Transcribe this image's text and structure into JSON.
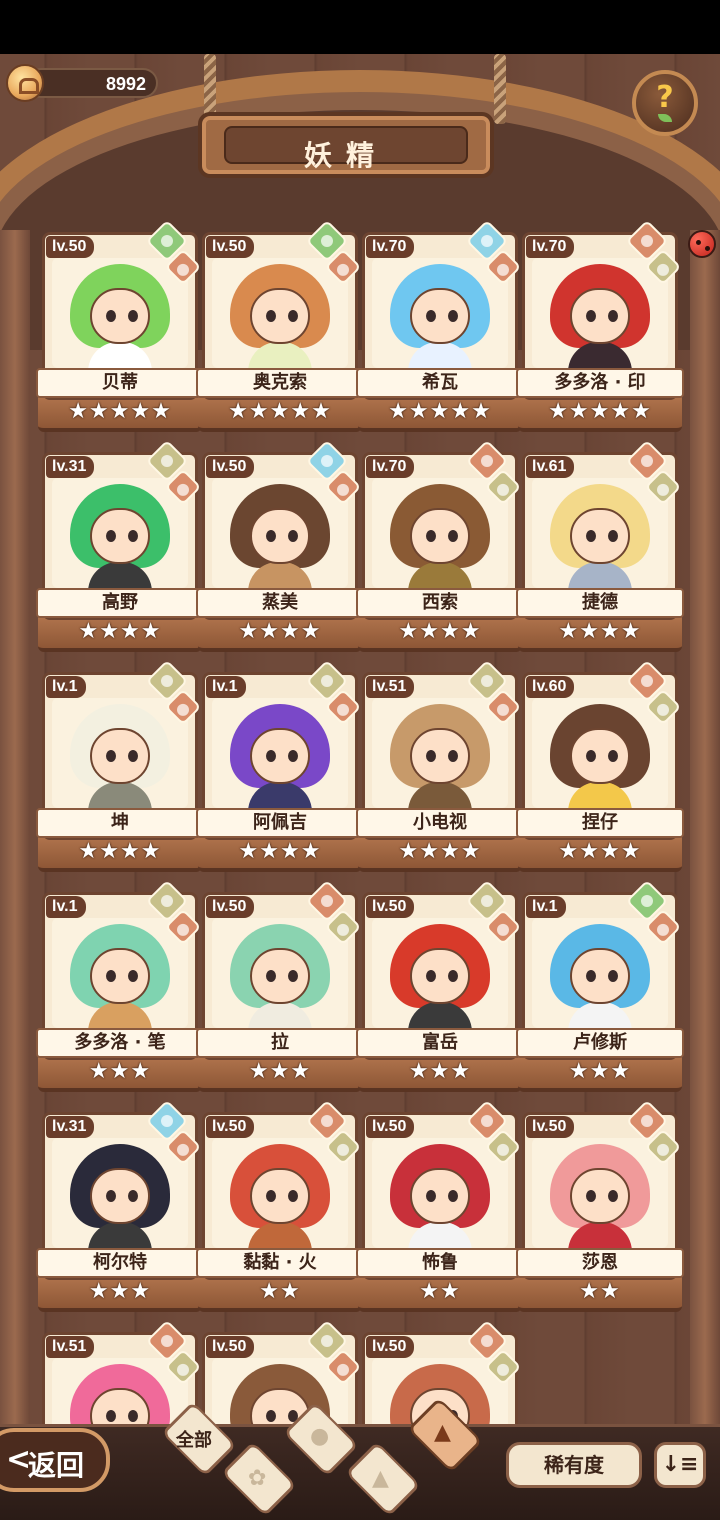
{
  "header": {
    "coins": "8992",
    "title": "妖精",
    "help_glyph": "?"
  },
  "colors": {
    "grass": "#8fc97a",
    "water": "#8fd3e6",
    "fire": "#d98c6a",
    "earth": "#c7c08a"
  },
  "fairies": [
    {
      "level": "lv.50",
      "name": "贝蒂",
      "stars": "★★★★★",
      "element": "grass-icon",
      "hair": "#7fd35c",
      "body": "#ffffff"
    },
    {
      "level": "lv.50",
      "name": "奥克索",
      "stars": "★★★★★",
      "element": "grass-icon",
      "hair": "#d98a4e",
      "body": "#e9f0c0"
    },
    {
      "level": "lv.70",
      "name": "希瓦",
      "stars": "★★★★★",
      "element": "water-icon",
      "hair": "#6fc7f0",
      "body": "#e8f2ff"
    },
    {
      "level": "lv.70",
      "name": "多多洛 · 印",
      "stars": "★★★★★",
      "element": "fire-icon",
      "hair": "#d0342e",
      "body": "#3a2a30"
    },
    {
      "level": "lv.31",
      "name": "高野",
      "stars": "★★★★",
      "element": "earth-icon",
      "hair": "#3cbf6a",
      "body": "#3a3a3a"
    },
    {
      "level": "lv.50",
      "name": "蒸美",
      "stars": "★★★★",
      "element": "water-icon",
      "hair": "#6b4630",
      "body": "#c79462"
    },
    {
      "level": "lv.70",
      "name": "西索",
      "stars": "★★★★",
      "element": "fire-icon",
      "hair": "#8a5a34",
      "body": "#9a7a3a"
    },
    {
      "level": "lv.61",
      "name": "捷德",
      "stars": "★★★★",
      "element": "fire-icon",
      "hair": "#f3d98a",
      "body": "#a7b4c8"
    },
    {
      "level": "lv.1",
      "name": "坤",
      "stars": "★★★★",
      "element": "earth-icon",
      "hair": "#f3f0e0",
      "body": "#8a8a7a"
    },
    {
      "level": "lv.1",
      "name": "阿佩吉",
      "stars": "★★★★",
      "element": "earth-icon",
      "hair": "#7a48c8",
      "body": "#3a3a6a"
    },
    {
      "level": "lv.51",
      "name": "小电视",
      "stars": "★★★★",
      "element": "earth-icon",
      "hair": "#c79a6a",
      "body": "#7a5a3a"
    },
    {
      "level": "lv.60",
      "name": "捏仔",
      "stars": "★★★★",
      "element": "fire-icon",
      "hair": "#6a4430",
      "body": "#f3c84a"
    },
    {
      "level": "lv.1",
      "name": "多多洛 · 笔",
      "stars": "★★★",
      "element": "earth-icon",
      "hair": "#7fd3b0",
      "body": "#d9a060"
    },
    {
      "level": "lv.50",
      "name": "拉",
      "stars": "★★★",
      "element": "fire-icon",
      "hair": "#8ad3b0",
      "body": "#f0ece0"
    },
    {
      "level": "lv.50",
      "name": "富岳",
      "stars": "★★★",
      "element": "earth-icon",
      "hair": "#d83a2a",
      "body": "#3a3a3a"
    },
    {
      "level": "lv.1",
      "name": "卢修斯",
      "stars": "★★★",
      "element": "grass-icon",
      "hair": "#5ab8e6",
      "body": "#f4f4f4"
    },
    {
      "level": "lv.31",
      "name": "柯尔特",
      "stars": "★★★",
      "element": "water-icon",
      "hair": "#2a2a3a",
      "body": "#3a3a3a"
    },
    {
      "level": "lv.50",
      "name": "黏黏 · 火",
      "stars": "★★",
      "element": "fire-icon",
      "hair": "#d8503a",
      "body": "#c0683a"
    },
    {
      "level": "lv.50",
      "name": "怖鲁",
      "stars": "★★",
      "element": "fire-icon",
      "hair": "#c8303a",
      "body": "#f4f4f4"
    },
    {
      "level": "lv.50",
      "name": "莎恩",
      "stars": "★★",
      "element": "fire-icon",
      "hair": "#f09a9a",
      "body": "#c8303a"
    },
    {
      "level": "lv.51",
      "name": "",
      "stars": "",
      "element": "fire-icon",
      "hair": "#f06a9a",
      "body": "#f06a9a"
    },
    {
      "level": "lv.50",
      "name": "",
      "stars": "",
      "element": "earth-icon",
      "hair": "#8a5a3a",
      "body": "#8a5a3a"
    },
    {
      "level": "lv.50",
      "name": "",
      "stars": "",
      "element": "fire-icon",
      "hair": "#c86a4a",
      "body": "#c86a4a"
    }
  ],
  "footer": {
    "back_arrow": "<",
    "back_label": "返回",
    "filter_all": "全部",
    "sort_label": "稀有度",
    "order_glyph": "↓≡"
  }
}
